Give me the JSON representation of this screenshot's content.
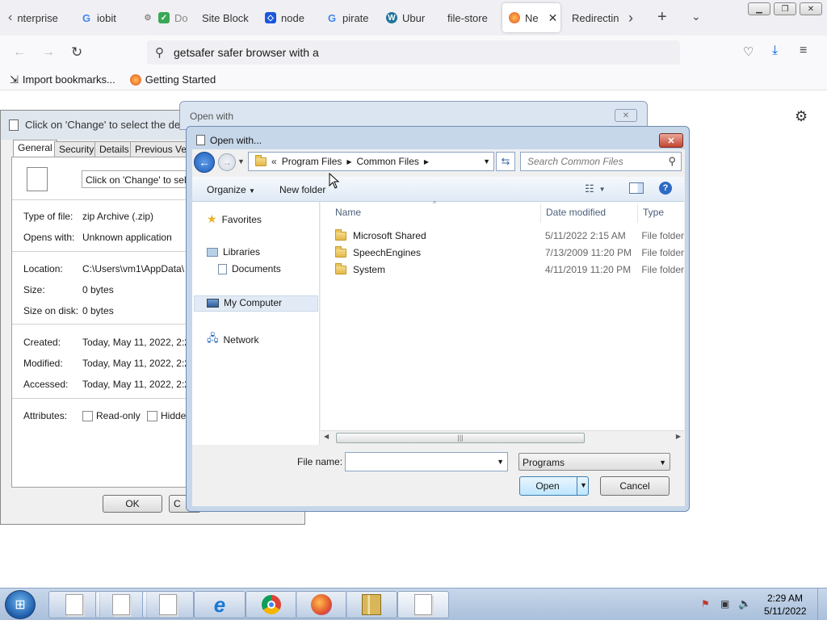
{
  "browser": {
    "tabs": [
      {
        "label": "nterprise",
        "icon": "chevron-left-icon"
      },
      {
        "label": "iobit",
        "icon": "google-icon"
      },
      {
        "label": "Do",
        "icon": "check-icon"
      },
      {
        "label": "Site Block",
        "icon": ""
      },
      {
        "label": "node",
        "icon": "bracket-icon"
      },
      {
        "label": "pirate",
        "icon": "google-icon"
      },
      {
        "label": "Ubur",
        "icon": "wordpress-icon"
      },
      {
        "label": "file-store",
        "icon": ""
      },
      {
        "label": "Ne",
        "icon": "firefox-icon"
      },
      {
        "label": "Redirectin",
        "icon": ""
      }
    ],
    "url": "getsafer safer browser with a",
    "bookmarks": [
      "Import bookmarks...",
      "Getting Started"
    ]
  },
  "properties": {
    "title": "Click on 'Change' to select the defa",
    "tabs": [
      "General",
      "Security",
      "Details",
      "Previous Ve"
    ],
    "filename": "Click on 'Change' to selec",
    "rows": [
      {
        "label": "Type of file:",
        "value": "zip Archive (.zip)"
      },
      {
        "label": "Opens with:",
        "value": "Unknown application"
      },
      {
        "label": "Location:",
        "value": "C:\\Users\\vm1\\AppData\\"
      },
      {
        "label": "Size:",
        "value": "0 bytes"
      },
      {
        "label": "Size on disk:",
        "value": "0 bytes"
      },
      {
        "label": "Created:",
        "value": "Today, May 11, 2022, 2:2"
      },
      {
        "label": "Modified:",
        "value": "Today, May 11, 2022, 2:2"
      },
      {
        "label": "Accessed:",
        "value": "Today, May 11, 2022, 2:2"
      }
    ],
    "attributes_label": "Attributes:",
    "readonly": "Read-only",
    "hidden": "Hidde",
    "ok": "OK",
    "cancel_partial": "C"
  },
  "openwith_back": {
    "title": "Open with"
  },
  "dialog": {
    "title": "Open with...",
    "path_prefix": "«",
    "path": [
      "Program Files",
      "Common Files"
    ],
    "search_placeholder": "Search Common Files",
    "organize": "Organize",
    "new_folder": "New folder",
    "nav": [
      "Favorites",
      "Libraries",
      "Documents",
      "My Computer",
      "Network"
    ],
    "columns": [
      "Name",
      "Date modified",
      "Type"
    ],
    "files": [
      {
        "name": "Microsoft Shared",
        "date": "5/11/2022 2:15 AM",
        "type": "File folder"
      },
      {
        "name": "SpeechEngines",
        "date": "7/13/2009 11:20 PM",
        "type": "File folder"
      },
      {
        "name": "System",
        "date": "4/11/2019 11:20 PM",
        "type": "File folder"
      }
    ],
    "filename_label": "File name:",
    "filename_value": "",
    "filter": "Programs",
    "open": "Open",
    "cancel": "Cancel"
  },
  "taskbar": {
    "time": "2:29 AM",
    "date": "5/11/2022"
  }
}
